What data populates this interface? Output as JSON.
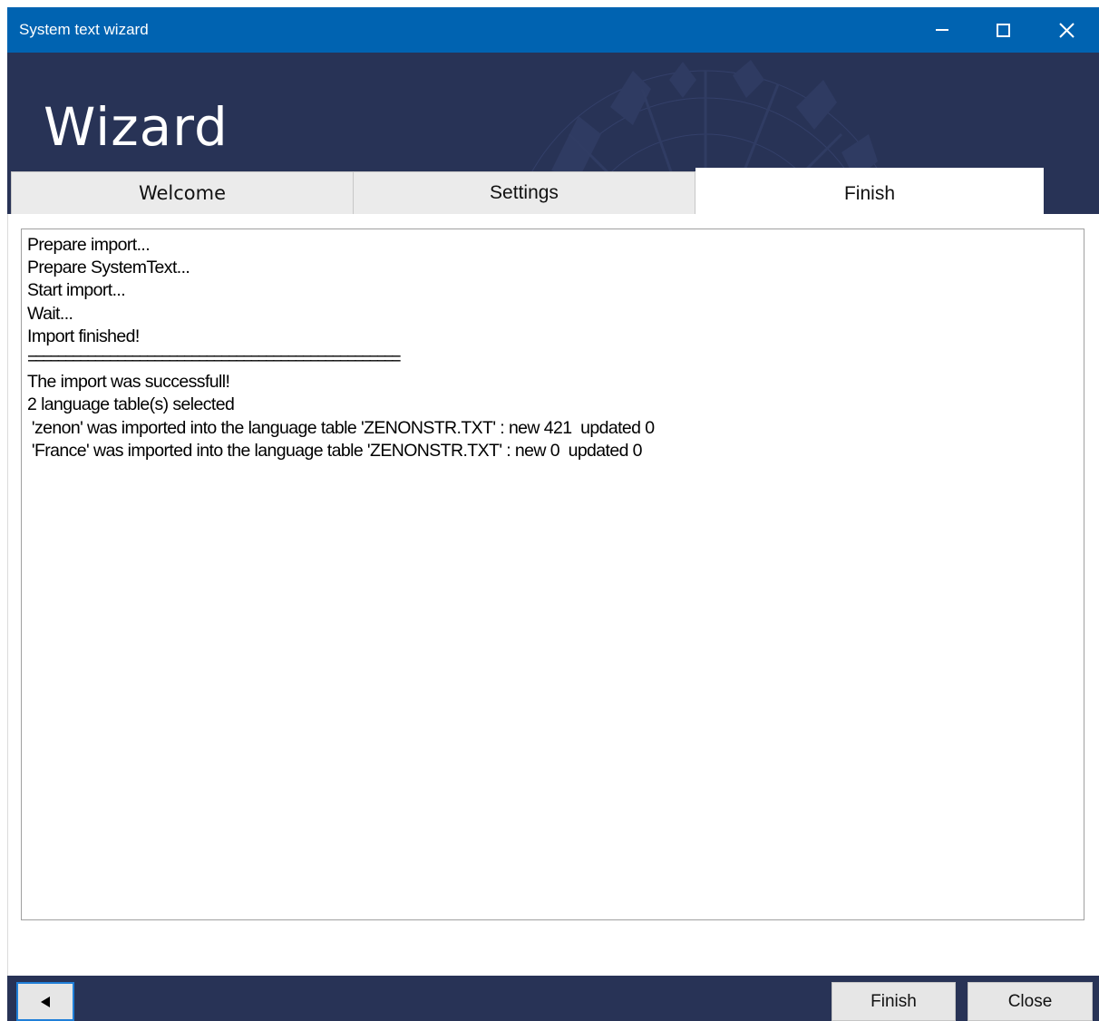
{
  "window": {
    "title": "System text wizard"
  },
  "titlebar_buttons": {
    "minimize_icon": "minimize-icon",
    "maximize_icon": "maximize-icon",
    "close_icon": "close-icon"
  },
  "header": {
    "title": "Wizard"
  },
  "tabs": [
    {
      "label": "Welcome",
      "active": false
    },
    {
      "label": "Settings",
      "active": false
    },
    {
      "label": "Finish",
      "active": true
    }
  ],
  "log": {
    "lines": [
      "Prepare import...",
      "Prepare SystemText...",
      "Start import...",
      "Wait...",
      "Import finished!",
      "==================================================",
      "The import was successfull!",
      "2 language table(s) selected",
      " 'zenon' was imported into the language table 'ZENONSTR.TXT' : new 421  updated 0",
      " 'France' was imported into the language table 'ZENONSTR.TXT' : new 0  updated 0"
    ]
  },
  "footer": {
    "back_icon": "triangle-left-icon",
    "finish_label": "Finish",
    "close_label": "Close"
  },
  "colors": {
    "titlebar": "#0063b1",
    "header": "#283356",
    "focus_border": "#1f7fd8"
  }
}
